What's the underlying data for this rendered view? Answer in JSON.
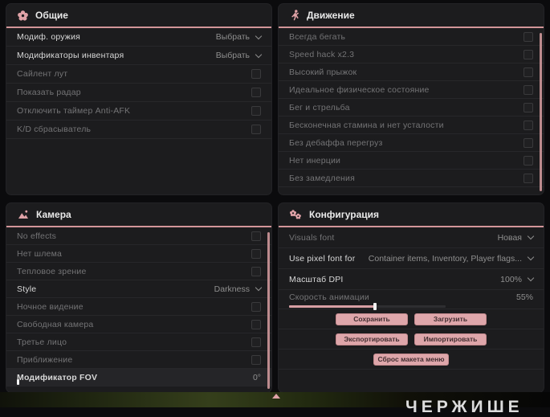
{
  "accent_color": "#dfa2a7",
  "header_underline_color": "#d29599",
  "button_color": "#dea6aa",
  "panels": {
    "general": {
      "title": "Общие",
      "icon": "flower-icon",
      "rows": [
        {
          "label": "Модиф. оружия",
          "control": "dropdown",
          "value": "Выбрать"
        },
        {
          "label": "Модификаторы инвентаря",
          "control": "dropdown",
          "value": "Выбрать"
        },
        {
          "label": "Сайлент лут",
          "control": "checkbox",
          "checked": false
        },
        {
          "label": "Показать радар",
          "control": "checkbox",
          "checked": false
        },
        {
          "label": "Отключить таймер Anti-AFK",
          "control": "checkbox",
          "checked": false
        },
        {
          "label": "K/D сбрасыватель",
          "control": "checkbox",
          "checked": false
        }
      ]
    },
    "movement": {
      "title": "Движение",
      "icon": "runner-icon",
      "rows": [
        {
          "label": "Всегда бегать",
          "control": "checkbox",
          "checked": false
        },
        {
          "label": "Speed hack x2.3",
          "control": "checkbox",
          "checked": false
        },
        {
          "label": "Высокий прыжок",
          "control": "checkbox",
          "checked": false
        },
        {
          "label": "Идеальное физическое состояние",
          "control": "checkbox",
          "checked": false
        },
        {
          "label": "Бег и стрельба",
          "control": "checkbox",
          "checked": false
        },
        {
          "label": "Бесконечная стамина и нет усталости",
          "control": "checkbox",
          "checked": false
        },
        {
          "label": "Без дебаффа перегруз",
          "control": "checkbox",
          "checked": false
        },
        {
          "label": "Нет инерции",
          "control": "checkbox",
          "checked": false
        },
        {
          "label": "Без замедления",
          "control": "checkbox",
          "checked": false
        }
      ]
    },
    "camera": {
      "title": "Камера",
      "icon": "image-icon",
      "rows": [
        {
          "label": "No effects",
          "control": "checkbox",
          "checked": false
        },
        {
          "label": "Нет шлема",
          "control": "checkbox",
          "checked": false
        },
        {
          "label": "Тепловое зрение",
          "control": "checkbox",
          "checked": false
        },
        {
          "label": "Style",
          "control": "dropdown",
          "value": "Darkness"
        },
        {
          "label": "Ночное видение",
          "control": "checkbox",
          "checked": false
        },
        {
          "label": "Свободная камера",
          "control": "checkbox",
          "checked": false
        },
        {
          "label": "Третье лицо",
          "control": "checkbox",
          "checked": false
        },
        {
          "label": "Приближение",
          "control": "checkbox",
          "checked": false
        },
        {
          "label": "Модификатор FOV",
          "control": "slider",
          "value": "0°"
        }
      ]
    },
    "config": {
      "title": "Конфигурация",
      "icon": "gears-icon",
      "rows": [
        {
          "label": "Visuals font",
          "control": "dropdown",
          "value": "Новая"
        },
        {
          "label": "Use pixel font for",
          "control": "dropdown",
          "value": "Container items, Inventory, Player flags..."
        },
        {
          "label": "Масштаб DPI",
          "control": "dropdown",
          "value": "100%"
        },
        {
          "label": "Скорость анимации",
          "control": "slider",
          "value": "55%"
        }
      ],
      "slider_percent": 55,
      "buttons": {
        "save": "Сохранить",
        "load": "Загрузить",
        "export": "Экспортировать",
        "import": "Импортировать",
        "reset": "Сброс макета меню"
      }
    }
  },
  "watermark": "ЧЕРЖИШЕ"
}
